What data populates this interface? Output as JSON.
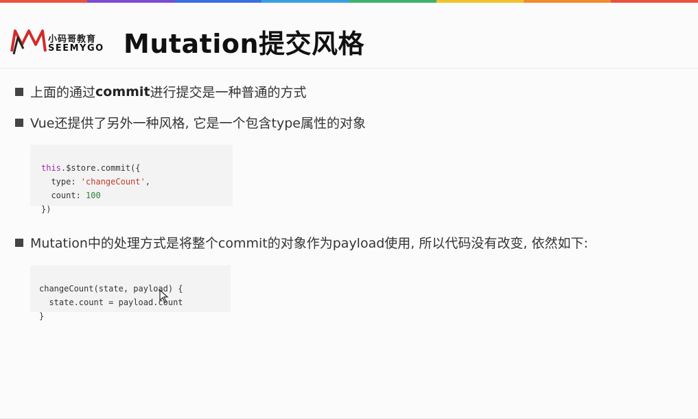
{
  "top_bar_colors": [
    "#e8523f",
    "#7b4bd1",
    "#3b6fe0",
    "#39a0e0",
    "#3cb36a",
    "#f2c12e",
    "#f28a2e",
    "#e8523f"
  ],
  "logo": {
    "cn": "小码哥教育",
    "en": "SEEMYGO"
  },
  "title": "Mutation提交风格",
  "bullets": [
    {
      "pre": "上面的通过",
      "strong": "commit",
      "post": "进行提交是一种普通的方式"
    },
    {
      "text": "Vue还提供了另外一种风格, 它是一个包含type属性的对象"
    },
    {
      "text": "Mutation中的处理方式是将整个commit的对象作为payload使用, 所以代码没有改变, 依然如下:"
    }
  ],
  "code1": {
    "l1_kw": "this",
    "l1_rest": ".$store.commit({",
    "l2_key": "  type: ",
    "l2_str": "'changeCount'",
    "l2_end": ",",
    "l3_key": "  count: ",
    "l3_num": "100",
    "l4": "})"
  },
  "code2": {
    "l1": "changeCount(state, payload) {",
    "l2": "  state.count = payload.count",
    "l3": "}"
  }
}
